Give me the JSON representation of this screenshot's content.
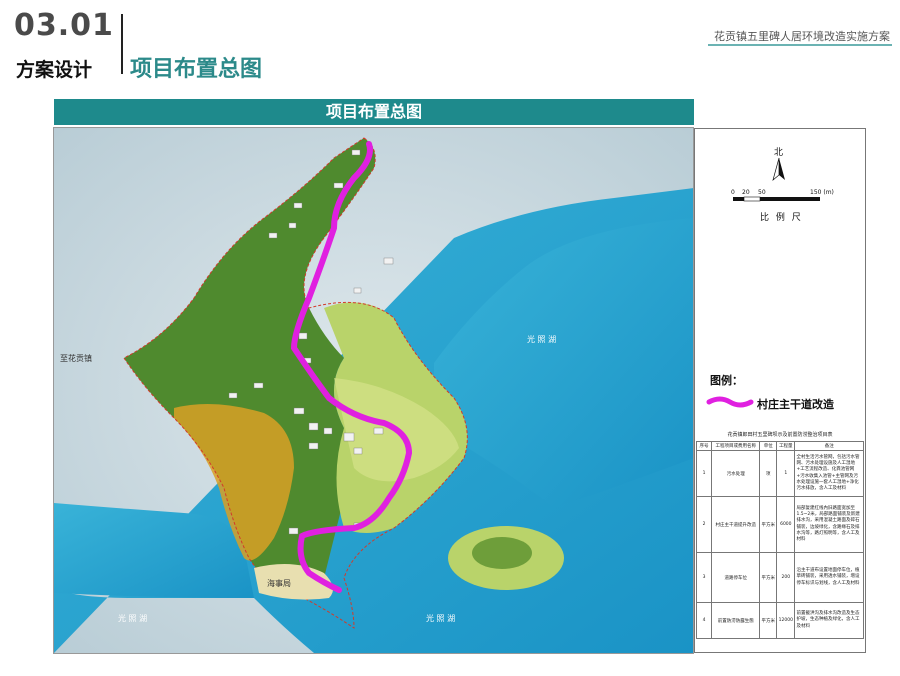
{
  "header": {
    "section_number": "03.01",
    "section_name": "方案设计",
    "page_title": "项目布置总图",
    "project_title": "花贡镇五里碑人居环境改造实施方案"
  },
  "banner": {
    "title": "项目布置总图"
  },
  "map": {
    "labels": {
      "lake_top": "光 照 湖",
      "lake_bottom_left": "光 照 湖",
      "lake_bottom_center": "光 照 湖",
      "to_town": "至花贡镇",
      "maritime": "海事局"
    },
    "colors": {
      "water": "#23a3cf",
      "forest": "#4f8a2e",
      "meadow": "#b9d36a",
      "road": "#e020e0"
    }
  },
  "compass": {
    "north_label": "北",
    "scale_ticks": [
      "0",
      "20",
      "50",
      "150 (m)"
    ],
    "scale_label": "比 例 尺"
  },
  "legend": {
    "title": "图例：",
    "item_label": "村庄主干道改造"
  },
  "table": {
    "caption": "花贡镇郎田村五里碑坝示及前置防涝整治项目表",
    "headers": [
      "序号",
      "工程项目或费用名称",
      "单位",
      "工程量",
      "备注"
    ],
    "rows": [
      {
        "no": "1",
        "name": "污水处理",
        "unit": "项",
        "qty": "1",
        "note": "全村生活污水管网，包括污水管网、污水处理设施及人工湿地+工艺流程改造、化粪池管网+污水收集入池管+主管网及污水处理设施一套人工湿地+净化污水排放，含人工及材料"
      },
      {
        "no": "2",
        "name": "村庄主干道提升改造",
        "unit": "平方米",
        "qty": "6000",
        "note": "局部复建红线內旧路面宽加至1.5~2米，局部路面铺装及新建排水沟，采用混凝土路面及碎石铺装，边坡绿化，含路缘石及排水沟等，路灯照明等，含人工及材料"
      },
      {
        "no": "3",
        "name": "道路停车位",
        "unit": "平方米",
        "qty": "200",
        "note": "沿主干道布设置地面停车位，植草砖铺装，采用透水铺装，增设停车标识与划线，含人工及材料"
      },
      {
        "no": "4",
        "name": "前置防涝防露生態",
        "unit": "平方米",
        "qty": "12000",
        "note": "前置截洪沟及排水沟改造及生态护坡，生态种植及绿化，含人工及材料"
      }
    ]
  }
}
